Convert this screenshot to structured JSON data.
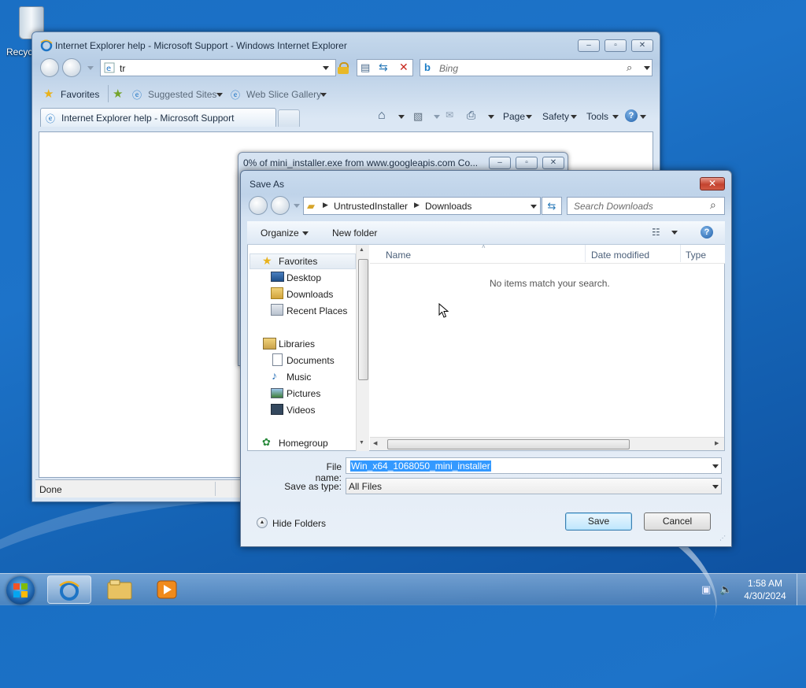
{
  "desktop": {
    "recycle_label": "Recycle Bin"
  },
  "ie": {
    "title": "Internet Explorer help - Microsoft Support - Windows Internet Explorer",
    "address_value": "tr",
    "search_placeholder": "Bing",
    "favorites_label": "Favorites",
    "suggested_sites_label": "Suggested Sites",
    "web_slice_label": "Web Slice Gallery",
    "tab_label": "Internet Explorer help - Microsoft Support",
    "page_menu": "Page",
    "safety_menu": "Safety",
    "tools_menu": "Tools",
    "status_text": "Done"
  },
  "download": {
    "title": "0% of mini_installer.exe from www.googleapis.com Co..."
  },
  "save_dialog": {
    "title": "Save As",
    "breadcrumb": [
      "UntrustedInstaller",
      "Downloads"
    ],
    "search_placeholder": "Search Downloads",
    "organize_label": "Organize",
    "new_folder_label": "New folder",
    "columns": [
      "Name",
      "Date modified",
      "Type"
    ],
    "empty_message": "No items match your search.",
    "tree": {
      "favorites": "Favorites",
      "favorites_items": [
        "Desktop",
        "Downloads",
        "Recent Places"
      ],
      "libraries": "Libraries",
      "libraries_items": [
        "Documents",
        "Music",
        "Pictures",
        "Videos"
      ],
      "homegroup": "Homegroup"
    },
    "file_name_label": "File name:",
    "file_name_value": "Win_x64_1068050_mini_installer",
    "save_type_label": "Save as type:",
    "save_type_value": "All Files",
    "hide_folders_label": "Hide Folders",
    "save_button": "Save",
    "cancel_button": "Cancel"
  },
  "taskbar": {
    "time": "1:58 AM",
    "date": "4/30/2024"
  }
}
